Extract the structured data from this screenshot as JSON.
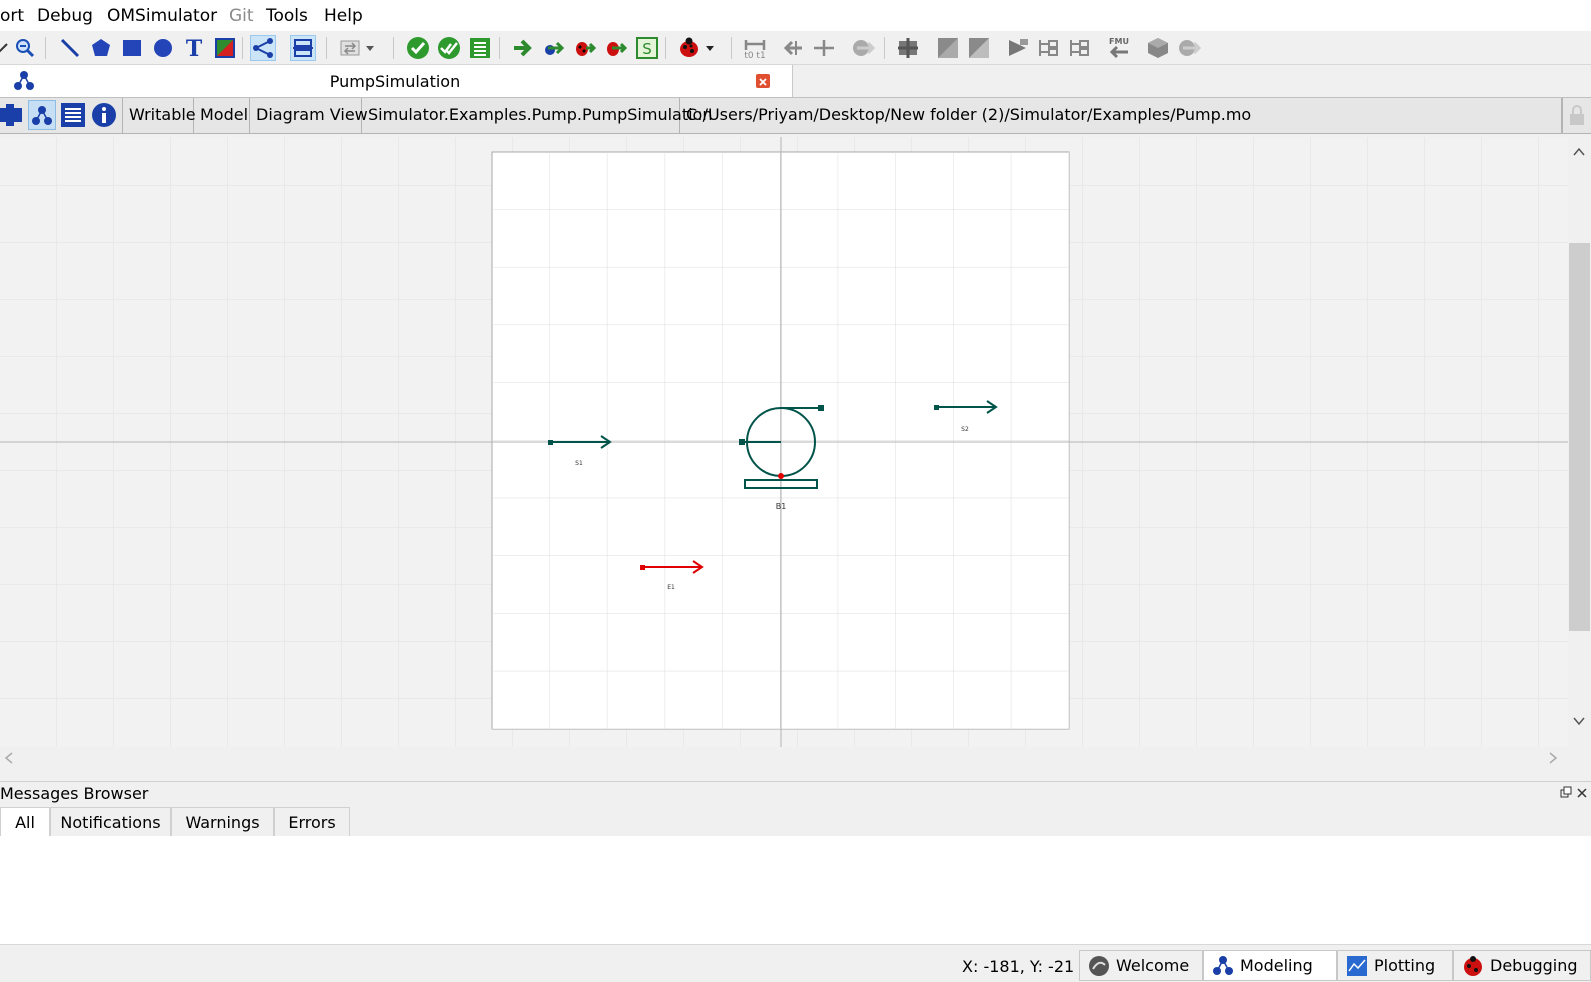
{
  "menu": {
    "items": [
      {
        "label": "ort",
        "disabled": false
      },
      {
        "label": "Debug",
        "disabled": false
      },
      {
        "label": "OMSimulator",
        "disabled": false
      },
      {
        "label": "Git",
        "disabled": true
      },
      {
        "label": "Tools",
        "disabled": false
      },
      {
        "label": "Help",
        "disabled": false
      }
    ]
  },
  "toolbar": {
    "icons": [
      "zoom-out-icon",
      "line-icon",
      "polygon-icon",
      "rectangle-icon",
      "ellipse-icon",
      "text-icon",
      "bitmap-icon",
      "connect-mode-icon",
      "transition-mode-icon",
      "swap-icon",
      "check-model-icon",
      "check-all-models-icon",
      "instantiate-model-icon",
      "simulate-icon",
      "simulate-setup-icon",
      "debug-icon",
      "algorithmic-debug-icon",
      "export-fmu-icon",
      "debugger-icon",
      "time-cursor-icon",
      "interactive-icon",
      "oms-icon",
      "fmu-import-icon"
    ],
    "fmu_label": "FMU"
  },
  "document_tab": {
    "title": "PumpSimulation"
  },
  "info_bar": {
    "writable": "Writable",
    "restriction": "Model",
    "view": "Diagram View",
    "class_name": "Simulator.Examples.Pump.PumpSimulation",
    "file_path": "C:/Users/Priyam/Desktop/New folder (2)/Simulator/Examples/Pump.mo"
  },
  "diagram": {
    "components": [
      {
        "name": "S1",
        "kind": "stream-inlet"
      },
      {
        "name": "S2",
        "kind": "stream-outlet"
      },
      {
        "name": "E1",
        "kind": "energy-stream"
      },
      {
        "name": "B1",
        "kind": "pump"
      }
    ],
    "colors": {
      "stream": "#00544a",
      "energy": "#e00000",
      "grid": "#dcdcdc",
      "axis": "#b4b4b4"
    }
  },
  "messages": {
    "title": "Messages Browser",
    "tabs": [
      "All",
      "Notifications",
      "Warnings",
      "Errors"
    ],
    "active_tab": "All"
  },
  "status": {
    "coordinates": "X: -181, Y: -21",
    "perspectives": [
      {
        "label": "Welcome",
        "icon": "welcome-icon"
      },
      {
        "label": "Modeling",
        "icon": "modeling-icon",
        "active": true
      },
      {
        "label": "Plotting",
        "icon": "plotting-icon"
      },
      {
        "label": "Debugging",
        "icon": "debugging-icon"
      }
    ]
  }
}
